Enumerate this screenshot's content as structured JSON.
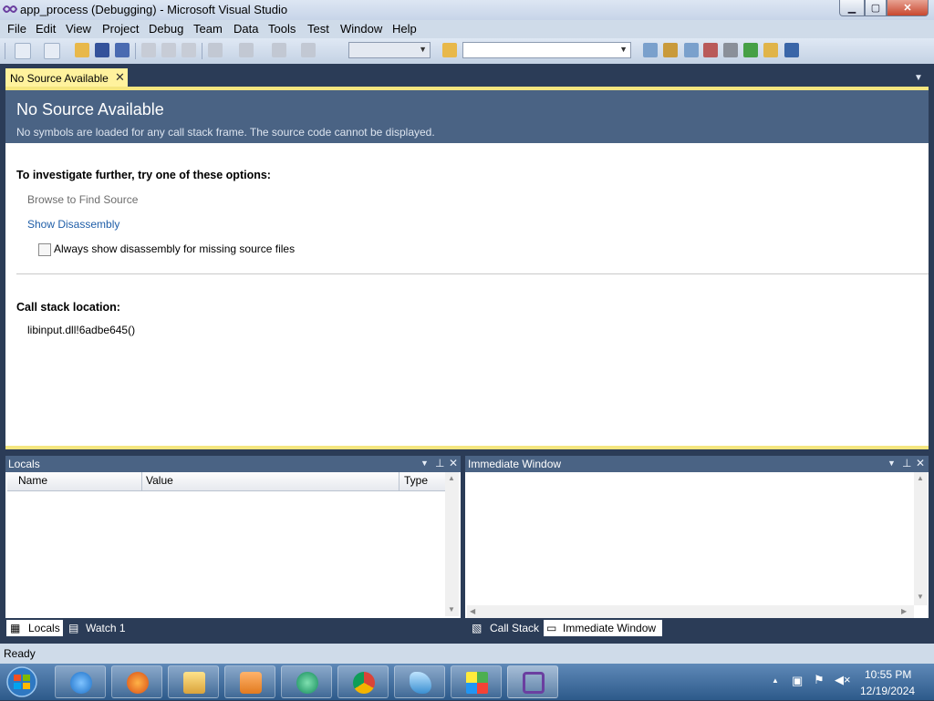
{
  "window": {
    "title": "app_process (Debugging) - Microsoft Visual Studio"
  },
  "menu": [
    "File",
    "Edit",
    "View",
    "Project",
    "Debug",
    "Team",
    "Data",
    "Tools",
    "Test",
    "Window",
    "Help"
  ],
  "doc_tab": {
    "label": "No Source Available",
    "close": "✕"
  },
  "no_source": {
    "heading": "No Source Available",
    "subheading": "No symbols are loaded for any call stack frame. The source code cannot be displayed.",
    "options_title": "To investigate further, try one of these options:",
    "browse_link": "Browse to Find Source",
    "disasm_link": "Show Disassembly",
    "checkbox_label": "Always show disassembly for missing source files",
    "checkbox_checked": false,
    "callstack_title": "Call stack location:",
    "callstack_value": "libinput.dll!6adbe645()"
  },
  "locals": {
    "title": "Locals",
    "columns": [
      "Name",
      "Value",
      "Type"
    ],
    "tabs": [
      "Locals",
      "Watch 1"
    ]
  },
  "immediate": {
    "title": "Immediate Window",
    "tabs": [
      "Call Stack",
      "Immediate Window"
    ]
  },
  "status": {
    "text": "Ready"
  },
  "taskbar": {
    "apps": [
      "Internet Explorer",
      "Firefox",
      "Windows Explorer",
      "Media Player",
      "Messenger",
      "Chrome",
      "Bird app",
      "Windows app",
      "Visual Studio"
    ],
    "time": "10:55 PM",
    "date": "12/19/2024"
  },
  "colors": {
    "accent": "#4a6384",
    "tab_yellow": "#fff29d",
    "link": "#1f5ea8"
  }
}
